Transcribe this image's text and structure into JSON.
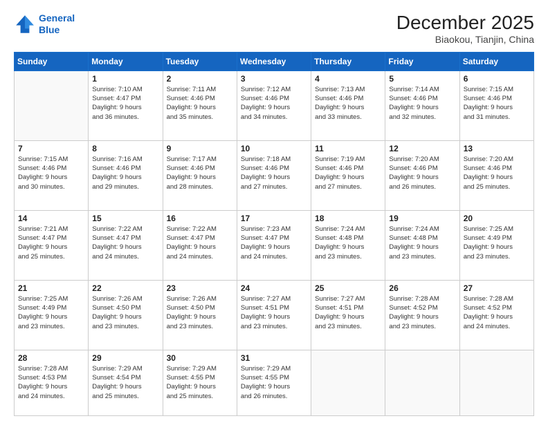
{
  "header": {
    "logo_line1": "General",
    "logo_line2": "Blue",
    "title": "December 2025",
    "subtitle": "Biaokou, Tianjin, China"
  },
  "days_of_week": [
    "Sunday",
    "Monday",
    "Tuesday",
    "Wednesday",
    "Thursday",
    "Friday",
    "Saturday"
  ],
  "weeks": [
    [
      {
        "day": "",
        "info": ""
      },
      {
        "day": "1",
        "info": "Sunrise: 7:10 AM\nSunset: 4:47 PM\nDaylight: 9 hours\nand 36 minutes."
      },
      {
        "day": "2",
        "info": "Sunrise: 7:11 AM\nSunset: 4:46 PM\nDaylight: 9 hours\nand 35 minutes."
      },
      {
        "day": "3",
        "info": "Sunrise: 7:12 AM\nSunset: 4:46 PM\nDaylight: 9 hours\nand 34 minutes."
      },
      {
        "day": "4",
        "info": "Sunrise: 7:13 AM\nSunset: 4:46 PM\nDaylight: 9 hours\nand 33 minutes."
      },
      {
        "day": "5",
        "info": "Sunrise: 7:14 AM\nSunset: 4:46 PM\nDaylight: 9 hours\nand 32 minutes."
      },
      {
        "day": "6",
        "info": "Sunrise: 7:15 AM\nSunset: 4:46 PM\nDaylight: 9 hours\nand 31 minutes."
      }
    ],
    [
      {
        "day": "7",
        "info": "Sunrise: 7:15 AM\nSunset: 4:46 PM\nDaylight: 9 hours\nand 30 minutes."
      },
      {
        "day": "8",
        "info": "Sunrise: 7:16 AM\nSunset: 4:46 PM\nDaylight: 9 hours\nand 29 minutes."
      },
      {
        "day": "9",
        "info": "Sunrise: 7:17 AM\nSunset: 4:46 PM\nDaylight: 9 hours\nand 28 minutes."
      },
      {
        "day": "10",
        "info": "Sunrise: 7:18 AM\nSunset: 4:46 PM\nDaylight: 9 hours\nand 27 minutes."
      },
      {
        "day": "11",
        "info": "Sunrise: 7:19 AM\nSunset: 4:46 PM\nDaylight: 9 hours\nand 27 minutes."
      },
      {
        "day": "12",
        "info": "Sunrise: 7:20 AM\nSunset: 4:46 PM\nDaylight: 9 hours\nand 26 minutes."
      },
      {
        "day": "13",
        "info": "Sunrise: 7:20 AM\nSunset: 4:46 PM\nDaylight: 9 hours\nand 25 minutes."
      }
    ],
    [
      {
        "day": "14",
        "info": "Sunrise: 7:21 AM\nSunset: 4:47 PM\nDaylight: 9 hours\nand 25 minutes."
      },
      {
        "day": "15",
        "info": "Sunrise: 7:22 AM\nSunset: 4:47 PM\nDaylight: 9 hours\nand 24 minutes."
      },
      {
        "day": "16",
        "info": "Sunrise: 7:22 AM\nSunset: 4:47 PM\nDaylight: 9 hours\nand 24 minutes."
      },
      {
        "day": "17",
        "info": "Sunrise: 7:23 AM\nSunset: 4:47 PM\nDaylight: 9 hours\nand 24 minutes."
      },
      {
        "day": "18",
        "info": "Sunrise: 7:24 AM\nSunset: 4:48 PM\nDaylight: 9 hours\nand 23 minutes."
      },
      {
        "day": "19",
        "info": "Sunrise: 7:24 AM\nSunset: 4:48 PM\nDaylight: 9 hours\nand 23 minutes."
      },
      {
        "day": "20",
        "info": "Sunrise: 7:25 AM\nSunset: 4:49 PM\nDaylight: 9 hours\nand 23 minutes."
      }
    ],
    [
      {
        "day": "21",
        "info": "Sunrise: 7:25 AM\nSunset: 4:49 PM\nDaylight: 9 hours\nand 23 minutes."
      },
      {
        "day": "22",
        "info": "Sunrise: 7:26 AM\nSunset: 4:50 PM\nDaylight: 9 hours\nand 23 minutes."
      },
      {
        "day": "23",
        "info": "Sunrise: 7:26 AM\nSunset: 4:50 PM\nDaylight: 9 hours\nand 23 minutes."
      },
      {
        "day": "24",
        "info": "Sunrise: 7:27 AM\nSunset: 4:51 PM\nDaylight: 9 hours\nand 23 minutes."
      },
      {
        "day": "25",
        "info": "Sunrise: 7:27 AM\nSunset: 4:51 PM\nDaylight: 9 hours\nand 23 minutes."
      },
      {
        "day": "26",
        "info": "Sunrise: 7:28 AM\nSunset: 4:52 PM\nDaylight: 9 hours\nand 23 minutes."
      },
      {
        "day": "27",
        "info": "Sunrise: 7:28 AM\nSunset: 4:52 PM\nDaylight: 9 hours\nand 24 minutes."
      }
    ],
    [
      {
        "day": "28",
        "info": "Sunrise: 7:28 AM\nSunset: 4:53 PM\nDaylight: 9 hours\nand 24 minutes."
      },
      {
        "day": "29",
        "info": "Sunrise: 7:29 AM\nSunset: 4:54 PM\nDaylight: 9 hours\nand 25 minutes."
      },
      {
        "day": "30",
        "info": "Sunrise: 7:29 AM\nSunset: 4:55 PM\nDaylight: 9 hours\nand 25 minutes."
      },
      {
        "day": "31",
        "info": "Sunrise: 7:29 AM\nSunset: 4:55 PM\nDaylight: 9 hours\nand 26 minutes."
      },
      {
        "day": "",
        "info": ""
      },
      {
        "day": "",
        "info": ""
      },
      {
        "day": "",
        "info": ""
      }
    ]
  ]
}
